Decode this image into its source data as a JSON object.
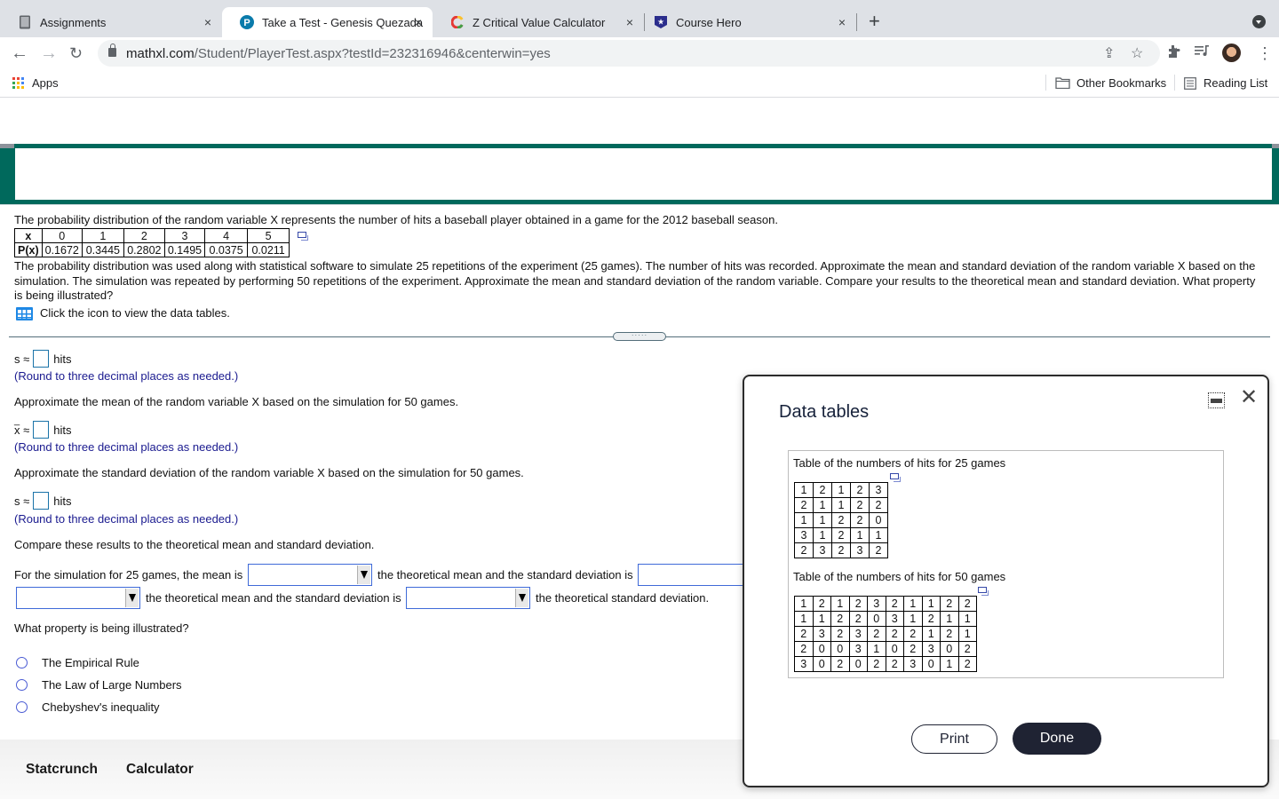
{
  "browser": {
    "tabs": [
      {
        "title": "Assignments",
        "icon": "tablet-icon",
        "active": false
      },
      {
        "title": "Take a Test - Genesis Quezada",
        "icon": "pearson-icon",
        "active": true
      },
      {
        "title": "Z Critical Value Calculator",
        "icon": "calculator-site-icon",
        "active": false
      },
      {
        "title": "Course Hero",
        "icon": "course-hero-icon",
        "active": false
      }
    ],
    "close_glyph": "×",
    "new_tab_glyph": "+",
    "url_domain": "mathxl.com",
    "url_path": "/Student/PlayerTest.aspx?testId=232316946&centerwin=yes",
    "bookmarks": {
      "apps_label": "Apps",
      "other_bookmarks_label": "Other Bookmarks",
      "reading_list_label": "Reading List"
    }
  },
  "question": {
    "intro": "The probability distribution of the random variable X represents the number of hits a baseball player obtained in a game for the 2012 baseball season.",
    "distribution": {
      "x_label": "x",
      "p_label": "P(x)",
      "x_values": [
        "0",
        "1",
        "2",
        "3",
        "4",
        "5"
      ],
      "p_values": [
        "0.1672",
        "0.3445",
        "0.2802",
        "0.1495",
        "0.0375",
        "0.0211"
      ]
    },
    "body": "The probability distribution was used along with statistical software to simulate 25 repetitions of the experiment (25 games). The number of hits was recorded. Approximate the mean and standard deviation of the random variable X based on the simulation. The simulation was repeated by performing 50 repetitions of the experiment. Approximate the mean and standard deviation of the random variable. Compare your results to the theoretical mean and standard deviation. What property is being illustrated?",
    "data_tables_link": "Click the icon to view the data tables."
  },
  "answers": {
    "s_symbol": "s ≈",
    "xbar_symbol": "x ≈",
    "unit": "hits",
    "round_hint": "(Round to three decimal places as needed.)",
    "s25_value": "",
    "mean50_prompt": "Approximate the mean of the random variable X based on the simulation for 50 games.",
    "mean50_value": "",
    "sd50_prompt": "Approximate the standard deviation of the random variable X based on the simulation for 50 games.",
    "sd50_value": "",
    "compare_prompt": "Compare these results to the theoretical mean and standard deviation.",
    "compare_line1_a": "For the simulation for 25 games, the mean is",
    "compare_line1_b": "the theoretical mean and the standard deviation is",
    "compare_line2_a": "the theoretical mean and the standard deviation is",
    "compare_line2_b": "the theoretical standard deviation.",
    "dropdowns": [
      "",
      "",
      "",
      ""
    ],
    "property_prompt": "What property is being illustrated?",
    "property_options": [
      "The Empirical Rule",
      "The Law of Large Numbers",
      "Chebyshev's inequality"
    ]
  },
  "divider_handle": "·····",
  "bottom_bar": {
    "statcrunch_label": "Statcrunch",
    "calculator_label": "Calculator"
  },
  "dialog": {
    "title": "Data tables",
    "close_glyph": "✕",
    "table25_caption": "Table of the numbers of hits for 25 games",
    "table25": [
      [
        "1",
        "2",
        "1",
        "2",
        "3"
      ],
      [
        "2",
        "1",
        "1",
        "2",
        "2"
      ],
      [
        "1",
        "1",
        "2",
        "2",
        "0"
      ],
      [
        "3",
        "1",
        "2",
        "1",
        "1"
      ],
      [
        "2",
        "3",
        "2",
        "3",
        "2"
      ]
    ],
    "table50_caption": "Table of the numbers of hits for 50 games",
    "table50": [
      [
        "1",
        "2",
        "1",
        "2",
        "3",
        "2",
        "1",
        "1",
        "2",
        "2"
      ],
      [
        "1",
        "1",
        "2",
        "2",
        "0",
        "3",
        "1",
        "2",
        "1",
        "1"
      ],
      [
        "2",
        "3",
        "2",
        "3",
        "2",
        "2",
        "2",
        "1",
        "2",
        "1"
      ],
      [
        "2",
        "0",
        "0",
        "3",
        "1",
        "0",
        "2",
        "3",
        "0",
        "2"
      ],
      [
        "3",
        "0",
        "2",
        "0",
        "2",
        "2",
        "3",
        "0",
        "1",
        "2"
      ]
    ],
    "print_label": "Print",
    "done_label": "Done"
  },
  "colors": {
    "header_teal": "#00695c",
    "hint_blue": "#1a1a8f",
    "done_button": "#1f2333"
  }
}
